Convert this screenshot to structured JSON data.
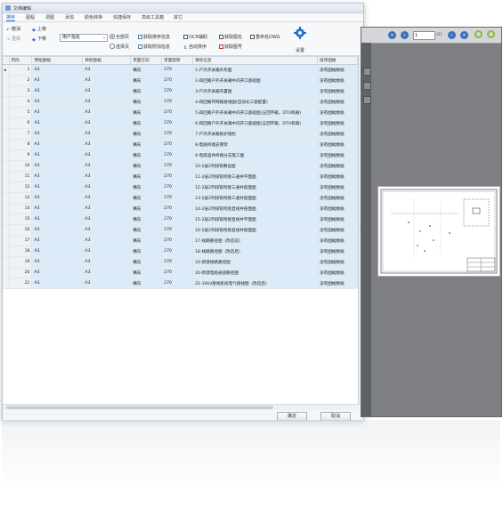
{
  "window": {
    "title": "文档编辑"
  },
  "menu": [
    "排序",
    "图幅",
    "调图",
    "添加",
    "颜色转换",
    "快捷保存",
    "高级工具箱",
    "其它"
  ],
  "ribbon": {
    "undo": "撤消",
    "redo": "重做",
    "move_up": "上移",
    "move_down": "下移",
    "select_value": "用户指名",
    "radio_all": "全部页",
    "radio_selected": "选择页",
    "get_sort_info": "获取排序信息",
    "get_drawing_info": "获取附加信息",
    "ocr": "OCR辅助",
    "auto_sort": "自动排序",
    "get_drawing_name": "获取图名",
    "get_drawing_no": "获取图号",
    "rename_dwg": "重命名DWG",
    "settings": "设置"
  },
  "table": {
    "headers": [
      "页码",
      "原始图幅",
      "目标图幅",
      "页面方向",
      "页面旋转",
      "目标信息",
      "排序图幅"
    ],
    "rows": [
      {
        "page": "1",
        "orig": "A3",
        "target": "A3",
        "orient": "横向",
        "rot": "270",
        "info": "1-户外开关箱外形图",
        "sort": "没有图幅数据"
      },
      {
        "page": "2",
        "orig": "A3",
        "target": "A3",
        "orient": "横向",
        "rot": "270",
        "info": "2-四回路户外开关箱中间开口基础图",
        "sort": "没有图幅数据"
      },
      {
        "page": "3",
        "orig": "A3",
        "target": "A3",
        "orient": "横向",
        "rot": "270",
        "info": "3-户外开关箱布置图",
        "sort": "没有图幅数据"
      },
      {
        "page": "4",
        "orig": "A3",
        "target": "A3",
        "orient": "横向",
        "rot": "270",
        "info": "4-四回路环网箱接线图(自动化三遥配置)",
        "sort": "没有图幅数据"
      },
      {
        "page": "5",
        "orig": "A3",
        "target": "A3",
        "orient": "横向",
        "rot": "270",
        "info": "5-四回路户外开关箱中间开口基础图(五回环箱，DTU机箱)",
        "sort": "没有图幅数据"
      },
      {
        "page": "6",
        "orig": "A3",
        "target": "A3",
        "orient": "横向",
        "rot": "270",
        "info": "6-四回路户外开关箱中间开口基础图(五回环箱，DTU机箱)",
        "sort": "没有图幅数据"
      },
      {
        "page": "7",
        "orig": "A3",
        "target": "A3",
        "orient": "横向",
        "rot": "270",
        "info": "7-户外开关箱防护围栏",
        "sort": "没有图幅数据"
      },
      {
        "page": "8",
        "orig": "A3",
        "target": "A3",
        "orient": "横向",
        "rot": "270",
        "info": "8-电缆终端支撑架",
        "sort": "没有图幅数据"
      },
      {
        "page": "9",
        "orig": "A3",
        "target": "A3",
        "orient": "横向",
        "rot": "270",
        "info": "9-电缆竖井终端分支施工图",
        "sort": "没有图幅数据"
      },
      {
        "page": "10",
        "orig": "A3",
        "target": "A3",
        "orient": "横向",
        "rot": "270",
        "info": "10-2层2列排管敷设图",
        "sort": "没有图幅数据"
      },
      {
        "page": "11",
        "orig": "A3",
        "target": "A3",
        "orient": "横向",
        "rot": "270",
        "info": "11-2层2列排管衔接三通井平面图",
        "sort": "没有图幅数据"
      },
      {
        "page": "12",
        "orig": "A3",
        "target": "A3",
        "orient": "横向",
        "rot": "270",
        "info": "12-2层2列排管衔接三通井剖面图",
        "sort": "没有图幅数据"
      },
      {
        "page": "13",
        "orig": "A3",
        "target": "A3",
        "orient": "横向",
        "rot": "270",
        "info": "13-2层2列排管衔接三通井剖面图",
        "sort": "没有图幅数据"
      },
      {
        "page": "14",
        "orig": "A3",
        "target": "A3",
        "orient": "横向",
        "rot": "270",
        "info": "14-2层2列排管衔接直线井剖面图",
        "sort": "没有图幅数据"
      },
      {
        "page": "15",
        "orig": "A3",
        "target": "A3",
        "orient": "横向",
        "rot": "270",
        "info": "15-2层2列排管衔接直线井平面图",
        "sort": "没有图幅数据"
      },
      {
        "page": "16",
        "orig": "A3",
        "target": "A3",
        "orient": "横向",
        "rot": "270",
        "info": "16-2层2列排管衔接直线井剖面图",
        "sort": "没有图幅数据"
      },
      {
        "page": "17",
        "orig": "A3",
        "target": "A3",
        "orient": "横向",
        "rot": "270",
        "info": "17-线路路径图（改造前）",
        "sort": "没有图幅数据"
      },
      {
        "page": "18",
        "orig": "A3",
        "target": "A3",
        "orient": "横向",
        "rot": "270",
        "info": "18-线路路径图（改造后）",
        "sort": "没有图幅数据"
      },
      {
        "page": "19",
        "orig": "A3",
        "target": "A3",
        "orient": "横向",
        "rot": "270",
        "info": "19-新建线路路径图",
        "sort": "没有图幅数据"
      },
      {
        "page": "20",
        "orig": "A3",
        "target": "A3",
        "orient": "横向",
        "rot": "270",
        "info": "20-新建电缆通道路径图",
        "sort": "没有图幅数据"
      },
      {
        "page": "21",
        "orig": "A3",
        "target": "A3",
        "orient": "横向",
        "rot": "270",
        "info": "21-10kV接线系统电气接线图（改造后）",
        "sort": "没有图幅数据"
      }
    ]
  },
  "buttons": {
    "ok": "确定",
    "cancel": "取消"
  },
  "preview": {
    "page_value": "1",
    "page_total": "/21",
    "colors": {
      "accent": "#3d6fba",
      "ring": "#8dbb2f"
    }
  }
}
